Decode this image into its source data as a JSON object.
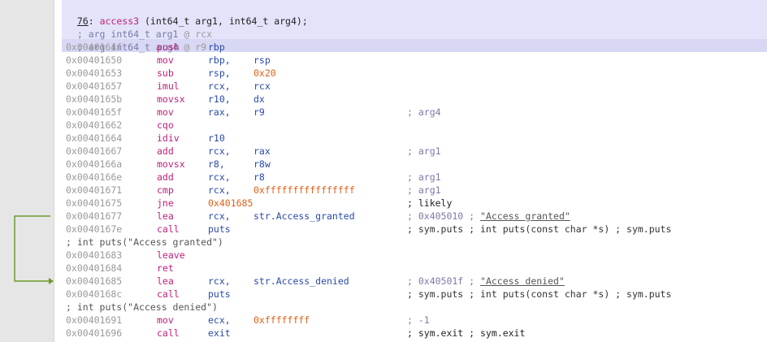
{
  "function_header": {
    "index": "76",
    "name": "access3",
    "signature": " (int64_t arg1, int64_t arg4);",
    "args": [
      {
        "text": "; arg int64_t arg1",
        "reg": " @ rcx"
      },
      {
        "text": "; arg int64_t arg4",
        "reg": " @ r9"
      }
    ]
  },
  "rows": [
    {
      "addr": "0x0040164f",
      "mn": "push",
      "op1": "rbp",
      "op2": "",
      "cmt": ""
    },
    {
      "addr": "0x00401650",
      "mn": "mov",
      "op1": "rbp,",
      "op2": "rsp",
      "cmt": ""
    },
    {
      "addr": "0x00401653",
      "mn": "sub",
      "op1": "rsp,",
      "op2": "0x20",
      "cmt": ""
    },
    {
      "addr": "0x00401657",
      "mn": "imul",
      "op1": "rcx,",
      "op2": "rcx",
      "cmt": ""
    },
    {
      "addr": "0x0040165b",
      "mn": "movsx",
      "op1": "r10,",
      "op2": "dx",
      "cmt": ""
    },
    {
      "addr": "0x0040165f",
      "mn": "mov",
      "op1": "rax,",
      "op2": "r9",
      "cmt": "; arg4"
    },
    {
      "addr": "0x00401662",
      "mn": "cqo",
      "op1": "",
      "op2": "",
      "cmt": ""
    },
    {
      "addr": "0x00401664",
      "mn": "idiv",
      "op1": "r10",
      "op2": "",
      "cmt": ""
    },
    {
      "addr": "0x00401667",
      "mn": "add",
      "op1": "rcx,",
      "op2": "rax",
      "cmt": "; arg1"
    },
    {
      "addr": "0x0040166a",
      "mn": "movsx",
      "op1": "r8,",
      "op2": "r8w",
      "cmt": ""
    },
    {
      "addr": "0x0040166e",
      "mn": "add",
      "op1": "rcx,",
      "op2": "r8",
      "cmt": "; arg1"
    },
    {
      "addr": "0x00401671",
      "mn": "cmp",
      "op1": "rcx,",
      "op2": "0xffffffffffffffff",
      "cmt": "; arg1"
    },
    {
      "addr": "0x00401675",
      "mn": "jne",
      "op1": "0x401685",
      "op2": "",
      "cmt": "; likely"
    },
    {
      "addr": "0x00401677",
      "mn": "lea",
      "op1": "rcx,",
      "op2": "str.Access_granted",
      "cmt": "; 0x405010 ; ",
      "cmt_str": "\"Access granted\""
    },
    {
      "addr": "0x0040167e",
      "mn": "call",
      "op1": "puts",
      "op2": "",
      "cmt": "; sym.puts ; int puts(const char *s) ; sym.puts"
    },
    {
      "wrap": "; int puts(\"Access granted\")"
    },
    {
      "addr": "0x00401683",
      "mn": "leave",
      "op1": "",
      "op2": "",
      "cmt": ""
    },
    {
      "addr": "0x00401684",
      "mn": "ret",
      "op1": "",
      "op2": "",
      "cmt": ""
    },
    {
      "addr": "0x00401685",
      "mn": "lea",
      "op1": "rcx,",
      "op2": "str.Access_denied",
      "cmt": "; 0x40501f ; ",
      "cmt_str": "\"Access denied\""
    },
    {
      "addr": "0x0040168c",
      "mn": "call",
      "op1": "puts",
      "op2": "",
      "cmt": "; sym.puts ; int puts(const char *s) ; sym.puts"
    },
    {
      "wrap": "; int puts(\"Access denied\")"
    },
    {
      "addr": "0x00401691",
      "mn": "mov",
      "op1": "ecx,",
      "op2": "0xffffffff",
      "cmt": "; -1"
    },
    {
      "addr": "0x00401696",
      "mn": "call",
      "op1": "exit",
      "op2": "",
      "cmt": "; sym.exit ; sym.exit"
    }
  ],
  "colors": {
    "mnemonic": "#c0207a",
    "register": "#2a4aa8",
    "number": "#e0601a",
    "jump_arrow": "#6a9a2a",
    "header_bg": "#e3e3fa"
  }
}
